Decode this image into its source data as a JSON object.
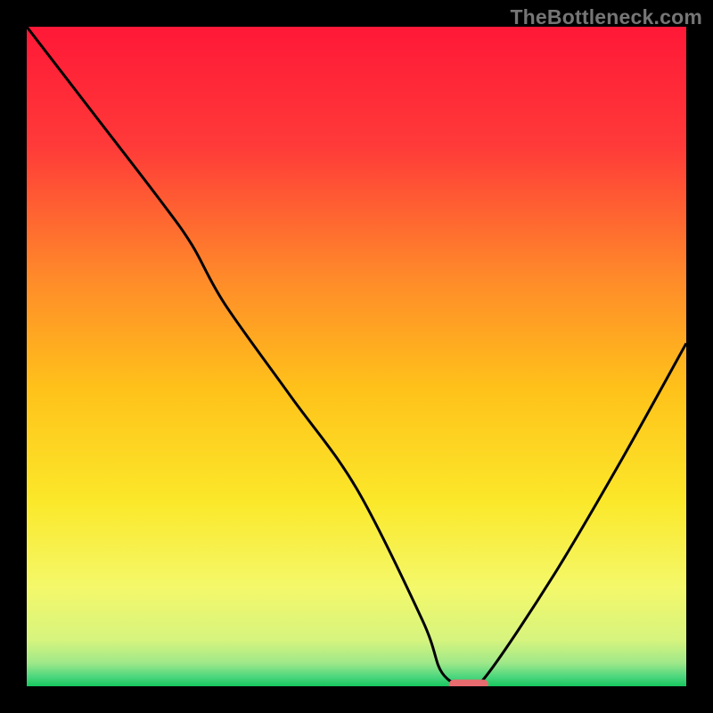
{
  "attribution": "TheBottleneck.com",
  "chart_data": {
    "type": "line",
    "title": "",
    "xlabel": "",
    "ylabel": "",
    "xlim": [
      0,
      100
    ],
    "ylim": [
      0,
      100
    ],
    "series": [
      {
        "name": "curve",
        "x": [
          0,
          10,
          20,
          25,
          30,
          40,
          50,
          60,
          63,
          67,
          70,
          80,
          90,
          100
        ],
        "y": [
          100,
          87,
          74,
          67,
          58,
          44,
          30,
          10,
          2,
          0,
          2,
          17,
          34,
          52
        ]
      }
    ],
    "marker": {
      "x": 67,
      "y": 0,
      "width": 6,
      "height": 1.5
    },
    "gradient_stops": [
      {
        "offset": 0,
        "color": "#ff1837"
      },
      {
        "offset": 0.18,
        "color": "#ff3a39"
      },
      {
        "offset": 0.38,
        "color": "#ff8a2a"
      },
      {
        "offset": 0.55,
        "color": "#ffc21a"
      },
      {
        "offset": 0.72,
        "color": "#fbe82a"
      },
      {
        "offset": 0.85,
        "color": "#f4f86a"
      },
      {
        "offset": 0.93,
        "color": "#d6f47e"
      },
      {
        "offset": 0.965,
        "color": "#9ee889"
      },
      {
        "offset": 0.985,
        "color": "#4fd77e"
      },
      {
        "offset": 1.0,
        "color": "#17c65f"
      }
    ],
    "marker_color": "#e86b6f",
    "curve_color": "#000000"
  }
}
